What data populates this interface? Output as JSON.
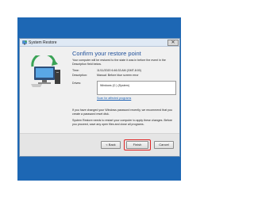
{
  "window": {
    "title": "System Restore",
    "close_glyph": "✕"
  },
  "main": {
    "heading": "Confirm your restore point",
    "intro": "Your computer will be restored to the state it was in before the event in the Description field below.",
    "time_label": "Time:",
    "time_value": "11/11/2020 6:46:33 AM (GMT-8:00)",
    "description_label": "Description:",
    "description_value": "Manual: Before blue screen error",
    "drives_label": "Drives:",
    "drive_item": "Windows (C:) (System)",
    "scan_link": "Scan for affected programs",
    "password_note": "If you have changed your Windows password recently, we recommend that you create a password reset disk.",
    "restart_note": "System Restore needs to restart your computer to apply these changes. Before you proceed, save any open files and close all programs."
  },
  "footer": {
    "back_label": "< Back",
    "finish_label": "Finish",
    "cancel_label": "Cancel"
  },
  "colors": {
    "desktop": "#1d67b4",
    "heading": "#1e4f9a",
    "link": "#1a5fb4",
    "highlight": "#e02323"
  },
  "icons": {
    "title": "system-restore-icon",
    "hero": "computer-restore-illustration",
    "close": "close-icon"
  }
}
